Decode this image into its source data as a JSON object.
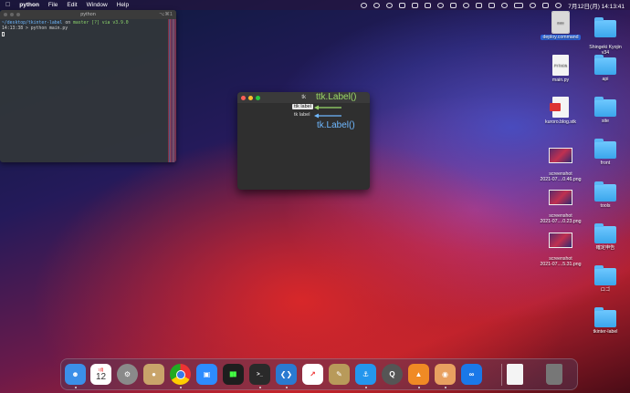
{
  "menubar": {
    "app_name": "python",
    "menus": [
      "File",
      "Edit",
      "Window",
      "Help"
    ],
    "clock": "7月12日(月)  14:13:41"
  },
  "terminal": {
    "title": "python",
    "shortcut": "⌥⌘1",
    "line1_path": "~/desktop/tkinter-label",
    "line1_on": "on",
    "line1_branch": "master [?] via",
    "line1_ver": "v3.9.0",
    "line2": "14:13:38 > python main.py"
  },
  "tk_window": {
    "title": "tk",
    "ttk_label": "ttk label",
    "tk_label": "tk label"
  },
  "annotations": {
    "ttk": "ttk.Label()",
    "tk": "tk.Label()",
    "colors": {
      "ttk": "#9bd96a",
      "tk": "#6fb8ff"
    }
  },
  "desktop": {
    "items": [
      {
        "label": "deploy.command",
        "kind": "doc",
        "icon": "exec-doc-icon",
        "doc_text": "exec"
      },
      {
        "label": "main.py",
        "kind": "doc",
        "icon": "python-file-icon",
        "doc_text": "PYTHON"
      },
      {
        "label": "kuroro.blog.stk",
        "kind": "doc",
        "icon": "pdf-doc-icon",
        "doc_text": ""
      },
      {
        "label": "screenshot\n2021-07....0.46.png",
        "kind": "shot",
        "icon": "image-icon"
      },
      {
        "label": "screenshot\n2021-07....0.23.png",
        "kind": "shot",
        "icon": "image-icon"
      },
      {
        "label": "screenshot\n2021-07....5.31.png",
        "kind": "shot",
        "icon": "image-icon"
      },
      {
        "label": "Shingeki Kyojin\nv34",
        "kind": "folder",
        "icon": "folder-icon"
      },
      {
        "label": "api",
        "kind": "folder",
        "icon": "folder-icon"
      },
      {
        "label": "site",
        "kind": "folder",
        "icon": "folder-icon"
      },
      {
        "label": "front",
        "kind": "folder",
        "icon": "folder-icon"
      },
      {
        "label": "tools",
        "kind": "folder",
        "icon": "folder-icon"
      },
      {
        "label": "確定申告",
        "kind": "folder",
        "icon": "folder-icon"
      },
      {
        "label": "ロゴ",
        "kind": "folder",
        "icon": "folder-icon"
      },
      {
        "label": "tkinter-label",
        "kind": "folder",
        "icon": "folder-icon"
      }
    ]
  },
  "dock": {
    "calendar_month": "7月",
    "calendar_day": "12",
    "items": [
      {
        "name": "finder-icon",
        "color": "#3b8fe8"
      },
      {
        "name": "calendar-icon",
        "color": "#ffffff"
      },
      {
        "name": "system-preferences-icon",
        "color": "#8a8a8a"
      },
      {
        "name": "contacts-icon",
        "color": "#c9a46a"
      },
      {
        "name": "chrome-icon",
        "color": "#ffffff"
      },
      {
        "name": "zoom-icon",
        "color": "#2d8cff"
      },
      {
        "name": "activity-monitor-icon",
        "color": "#1e1e1e"
      },
      {
        "name": "terminal-icon",
        "color": "#2a2a2a"
      },
      {
        "name": "vscode-icon",
        "color": "#2a7ad1"
      },
      {
        "name": "stocks-icon",
        "color": "#ffffff"
      },
      {
        "name": "script-editor-icon",
        "color": "#b89a5a"
      },
      {
        "name": "docker-icon",
        "color": "#2496ed"
      },
      {
        "name": "quicktime-icon",
        "color": "#555"
      },
      {
        "name": "drawio-icon",
        "color": "#f08a24"
      },
      {
        "name": "app-icon",
        "color": "#e8a060"
      },
      {
        "name": "infinity-icon",
        "color": "#1a78e8"
      },
      {
        "name": "document-icon",
        "color": "#f4f4f4"
      },
      {
        "name": "trash-icon",
        "color": "#777"
      }
    ]
  }
}
